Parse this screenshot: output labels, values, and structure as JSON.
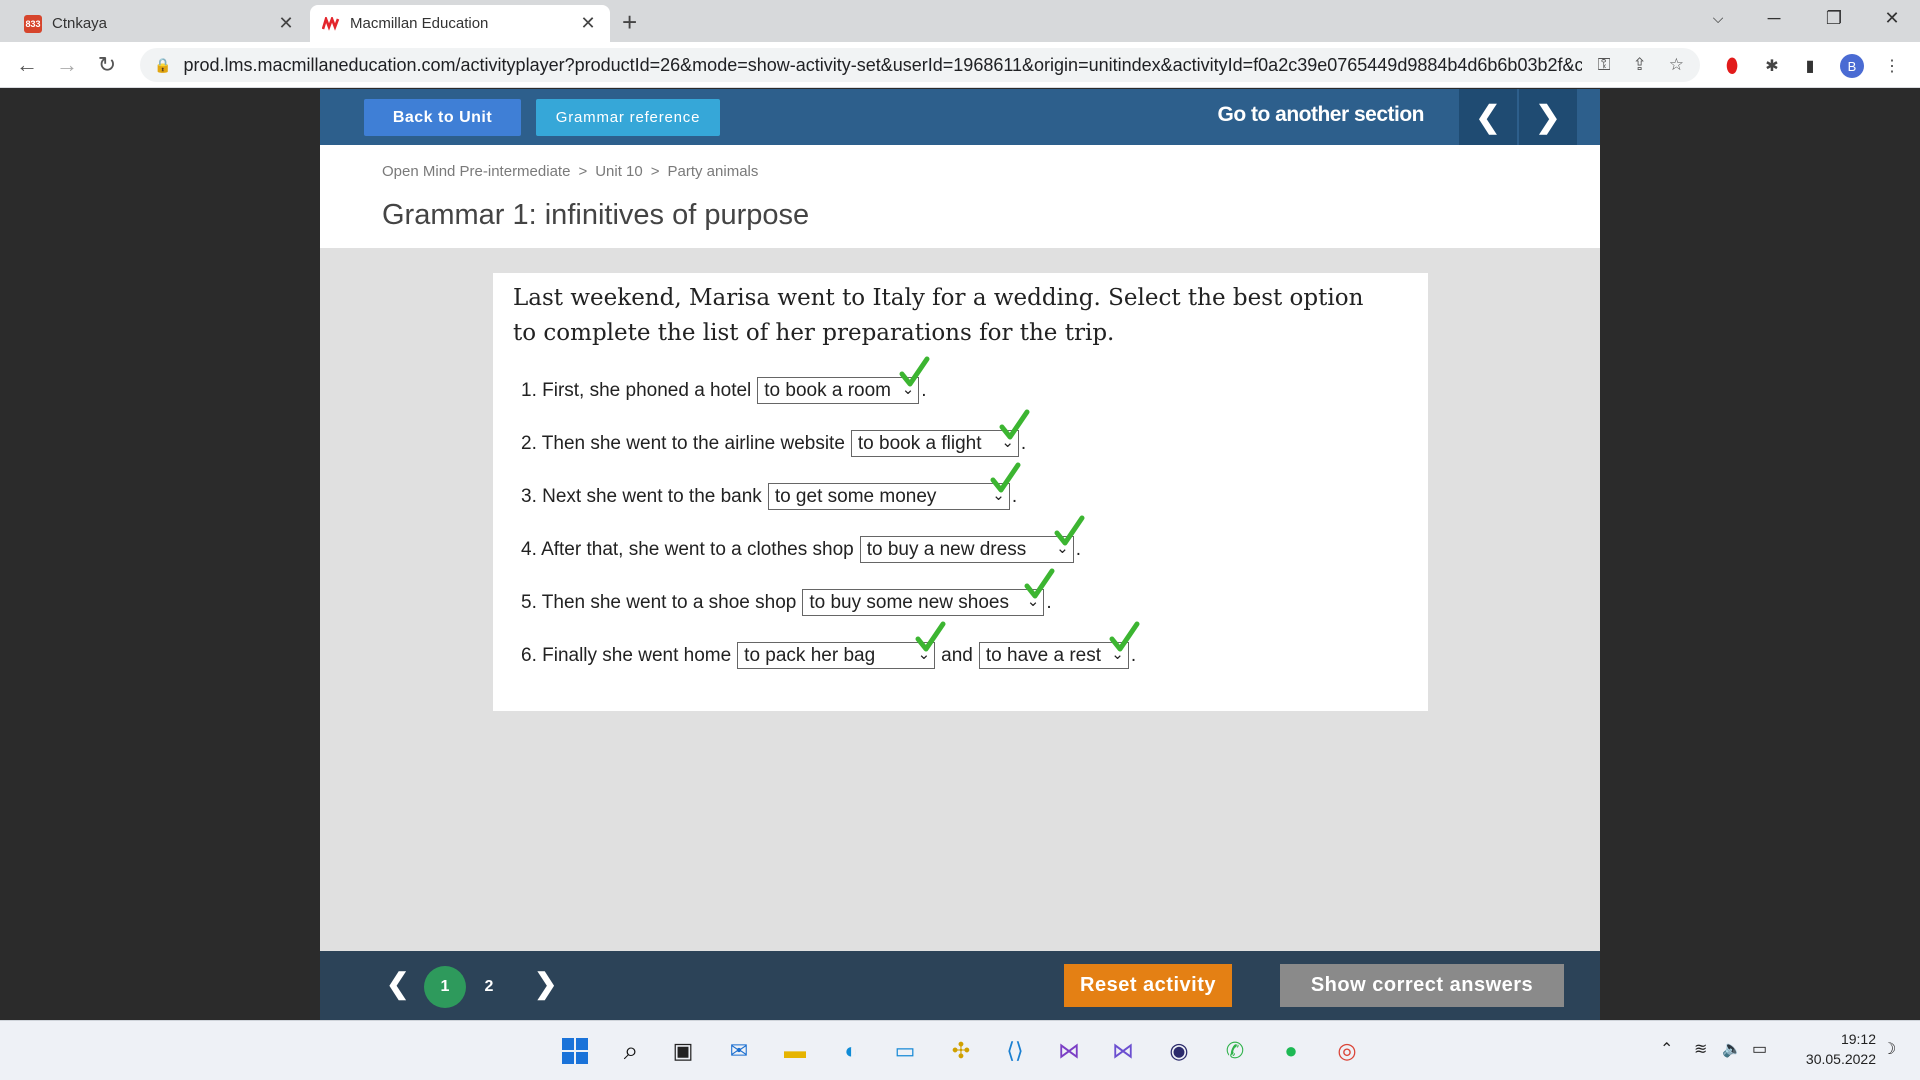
{
  "browser": {
    "tabs": [
      {
        "title": "Ctnkaya",
        "badge": "833",
        "active": false
      },
      {
        "title": "Macmillan Education",
        "active": true
      }
    ],
    "url": "prod.lms.macmillaneducation.com/activityplayer?productId=26&mode=show-activity-set&userId=1968611&origin=unitindex&activityId=f0a2c39e0765449d9884b4d6b6b03b2f&c...",
    "profile_initial": "B"
  },
  "topbar": {
    "back_label": "Back to Unit",
    "grammar_label": "Grammar reference",
    "goto_label": "Go to another section",
    "prev_arrow": "❮",
    "next_arrow": "❯"
  },
  "breadcrumb": {
    "items": [
      "Open Mind Pre-intermediate",
      "Unit 10",
      "Party animals"
    ],
    "separator": ">"
  },
  "page_title": "Grammar 1: infinitives of purpose",
  "activity": {
    "instructions": "Last weekend, Marisa went to Italy for a wedding. Select the best option to complete the list of her preparations for the trip.",
    "questions": [
      {
        "prompt": "1. First, she phoned a hotel",
        "answer": "to book a room",
        "correct": true
      },
      {
        "prompt": "2. Then she went to the airline website",
        "answer": "to book a flight",
        "correct": true
      },
      {
        "prompt": "3. Next she went to the bank",
        "answer": "to get some money",
        "correct": true
      },
      {
        "prompt": "4. After that, she went to a clothes shop",
        "answer": "to buy a new dress",
        "correct": true
      },
      {
        "prompt": "5. Then she went to a shoe shop",
        "answer": "to buy some new shoes",
        "correct": true
      },
      {
        "prompt": "6. Finally she went home",
        "answer": "to pack her bag",
        "connector": "and",
        "answer2": "to have a rest",
        "correct": true
      }
    ]
  },
  "footer": {
    "pages": [
      "1",
      "2"
    ],
    "current_page": "1",
    "reset_label": "Reset activity",
    "show_label": "Show correct answers"
  },
  "taskbar": {
    "time": "19:12",
    "date": "30.05.2022"
  },
  "colors": {
    "topbar": "#2d5f8c",
    "reset": "#e48014",
    "current_page": "#2e9a5c",
    "tick": "#3cb531"
  }
}
